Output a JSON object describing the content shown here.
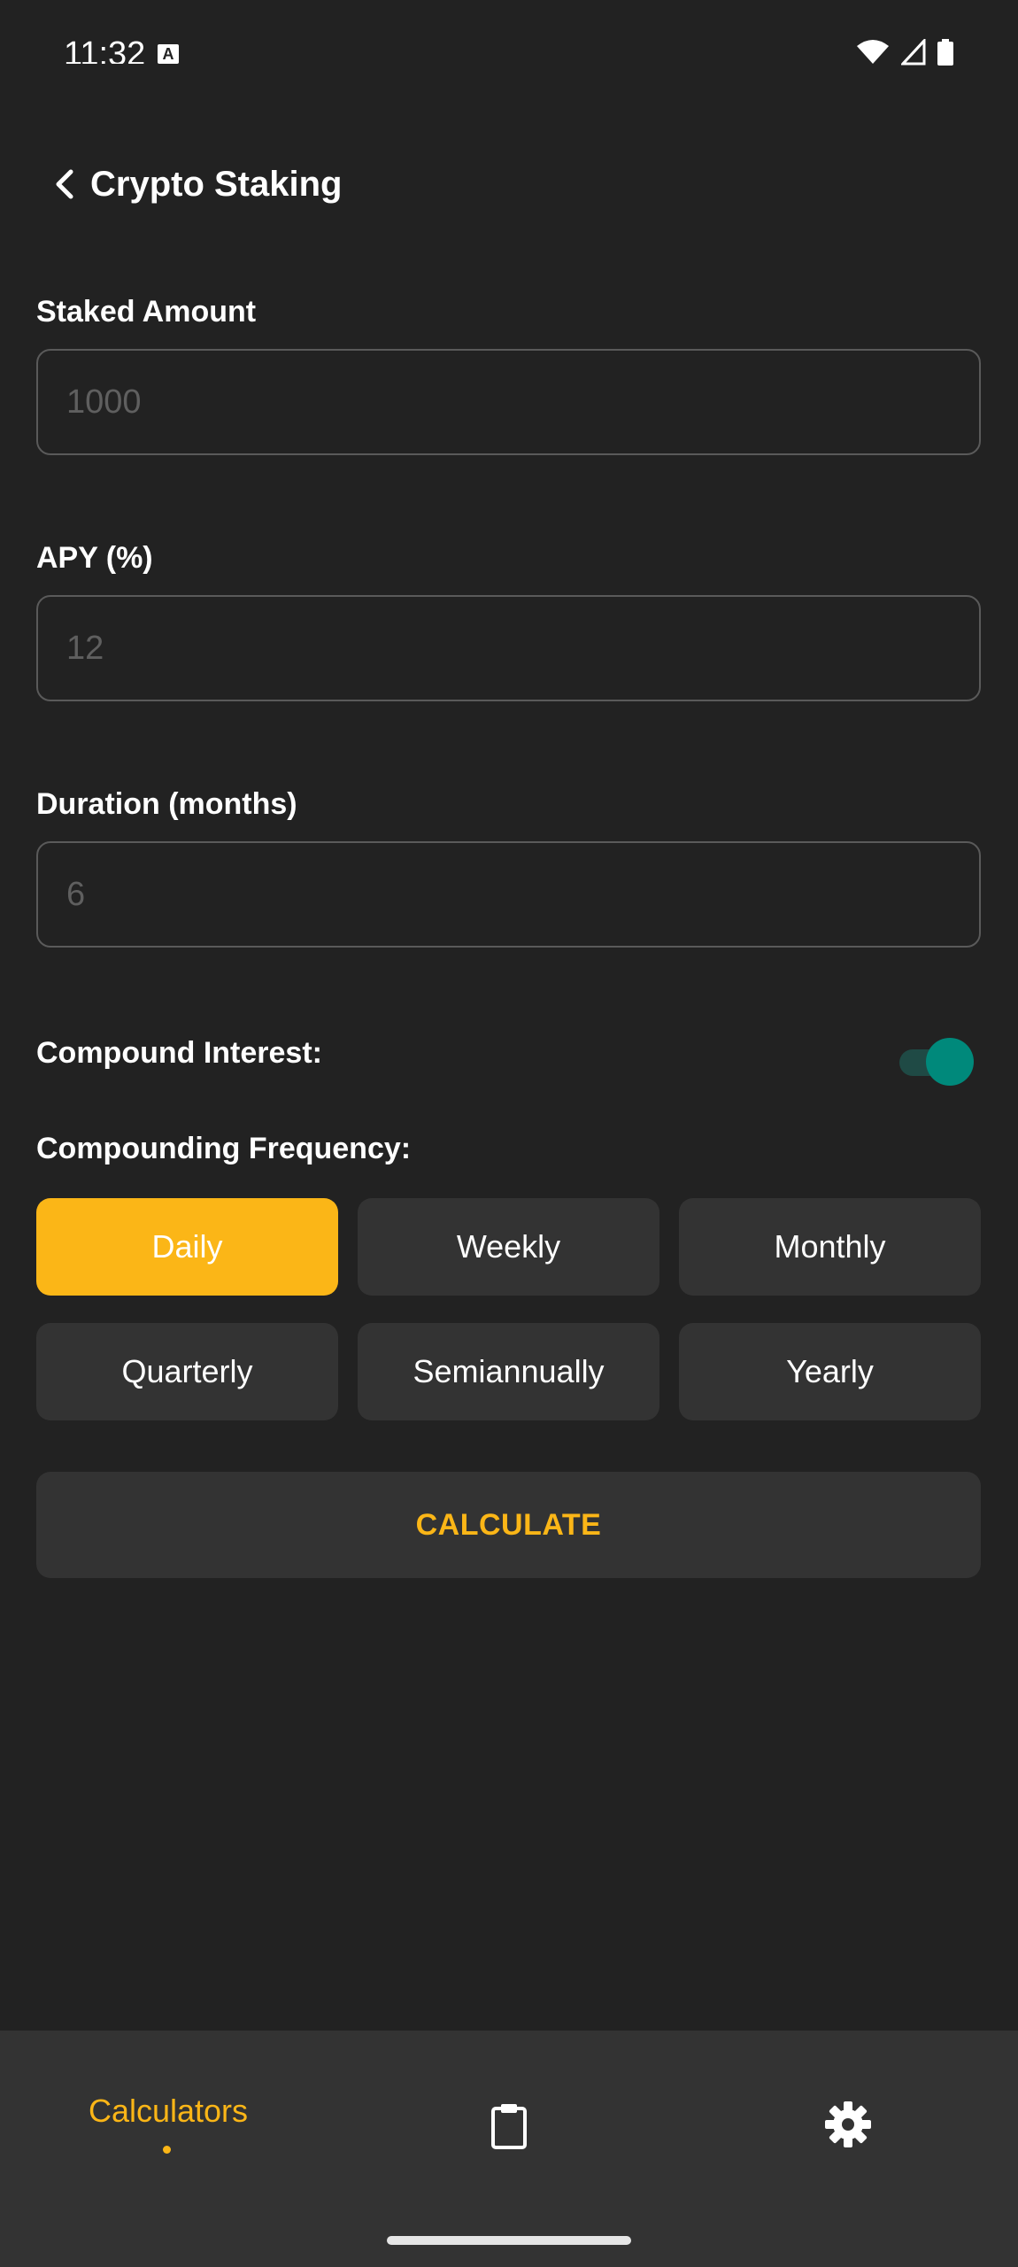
{
  "status_bar": {
    "time": "11:32",
    "notification_icon": "a-icon",
    "icons": [
      "wifi-icon",
      "signal-icon",
      "battery-icon"
    ]
  },
  "app_bar": {
    "title": "Crypto Staking",
    "back_icon": "chevron-left-icon"
  },
  "form": {
    "staked_amount": {
      "label": "Staked Amount",
      "placeholder": "1000",
      "value": ""
    },
    "apy": {
      "label": "APY (%)",
      "placeholder": "12",
      "value": ""
    },
    "duration": {
      "label": "Duration (months)",
      "placeholder": "6",
      "value": ""
    },
    "compound": {
      "label": "Compound Interest:",
      "enabled": true
    },
    "frequency": {
      "label": "Compounding Frequency:",
      "options": [
        "Daily",
        "Weekly",
        "Monthly",
        "Quarterly",
        "Semiannually",
        "Yearly"
      ],
      "selected": "Daily"
    },
    "calculate_label": "CALCULATE"
  },
  "bottom_nav": {
    "items": [
      {
        "label": "Calculators",
        "icon": "",
        "active": true
      },
      {
        "label": "",
        "icon": "clipboard-icon",
        "active": false
      },
      {
        "label": "",
        "icon": "gear-icon",
        "active": false
      }
    ]
  },
  "colors": {
    "background": "#222222",
    "surface": "#333333",
    "accent": "#fbb617",
    "toggle": "#00897b"
  }
}
